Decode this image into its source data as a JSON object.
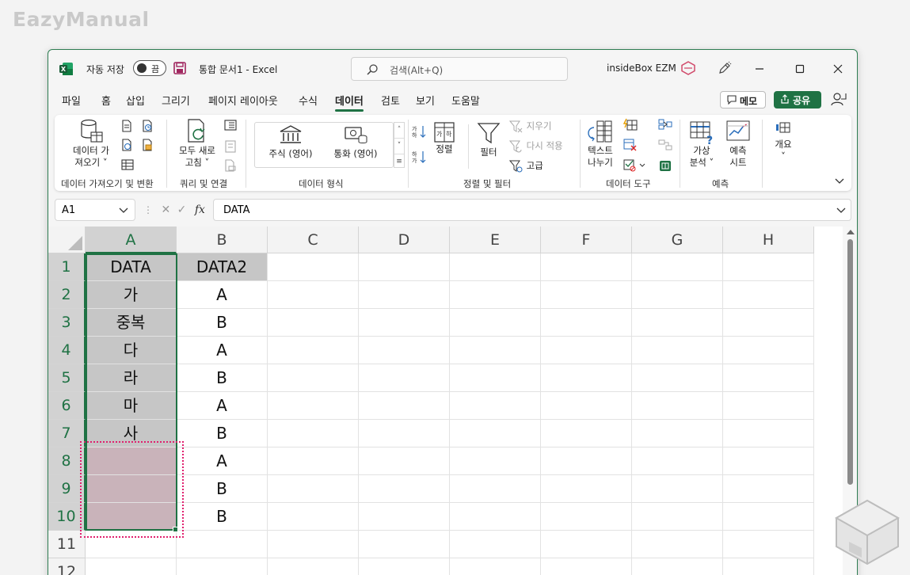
{
  "watermark": "EazyManual",
  "titlebar": {
    "autosave_label": "자동 저장",
    "autosave_state": "끔",
    "doc_title": "통합 문서1  -  Excel",
    "search_placeholder": "검색(Alt+Q)",
    "account": "insideBox EZM"
  },
  "tabs": [
    "파일",
    "홈",
    "삽입",
    "그리기",
    "페이지 레이아웃",
    "수식",
    "데이터",
    "검토",
    "보기",
    "도움말"
  ],
  "active_tab": "데이터",
  "tab_buttons": {
    "memo": "메모",
    "share": "공유"
  },
  "ribbon": {
    "get_data": {
      "line1": "데이터 가",
      "line2": "져오기"
    },
    "refresh_all": {
      "line1": "모두 새로",
      "line2": "고침"
    },
    "stock": "주식 (영어)",
    "currency": "통화 (영어)",
    "sort": "정렬",
    "filter": "필터",
    "clear": "지우기",
    "reapply": "다시 적용",
    "advanced": "고급",
    "text_to_columns": {
      "line1": "텍스트",
      "line2": "나누기"
    },
    "what_if": {
      "line1": "가상",
      "line2": "분석"
    },
    "forecast_sheet": {
      "line1": "예측",
      "line2": "시트"
    },
    "outline": "개요",
    "groups": {
      "get_transform": "데이터 가져오기 및 변환",
      "queries": "쿼리 및 연결",
      "data_types": "데이터 형식",
      "sort_filter": "정렬 및 필터",
      "data_tools": "데이터 도구",
      "forecast": "예측"
    }
  },
  "formula_bar": {
    "name_box": "A1",
    "fx": "fx",
    "value": "DATA"
  },
  "columns": [
    "A",
    "B",
    "C",
    "D",
    "E",
    "F",
    "G",
    "H"
  ],
  "rows": [
    "1",
    "2",
    "3",
    "4",
    "5",
    "6",
    "7",
    "8",
    "9",
    "10",
    "11",
    "12"
  ],
  "cells": {
    "A": [
      "DATA",
      "가",
      "중복",
      "다",
      "라",
      "마",
      "사",
      "",
      "",
      ""
    ],
    "B": [
      "DATA2",
      "A",
      "B",
      "A",
      "B",
      "A",
      "B",
      "A",
      "B",
      "B"
    ]
  },
  "colors": {
    "accent": "#1f7244",
    "highlight": "#e0206e"
  }
}
